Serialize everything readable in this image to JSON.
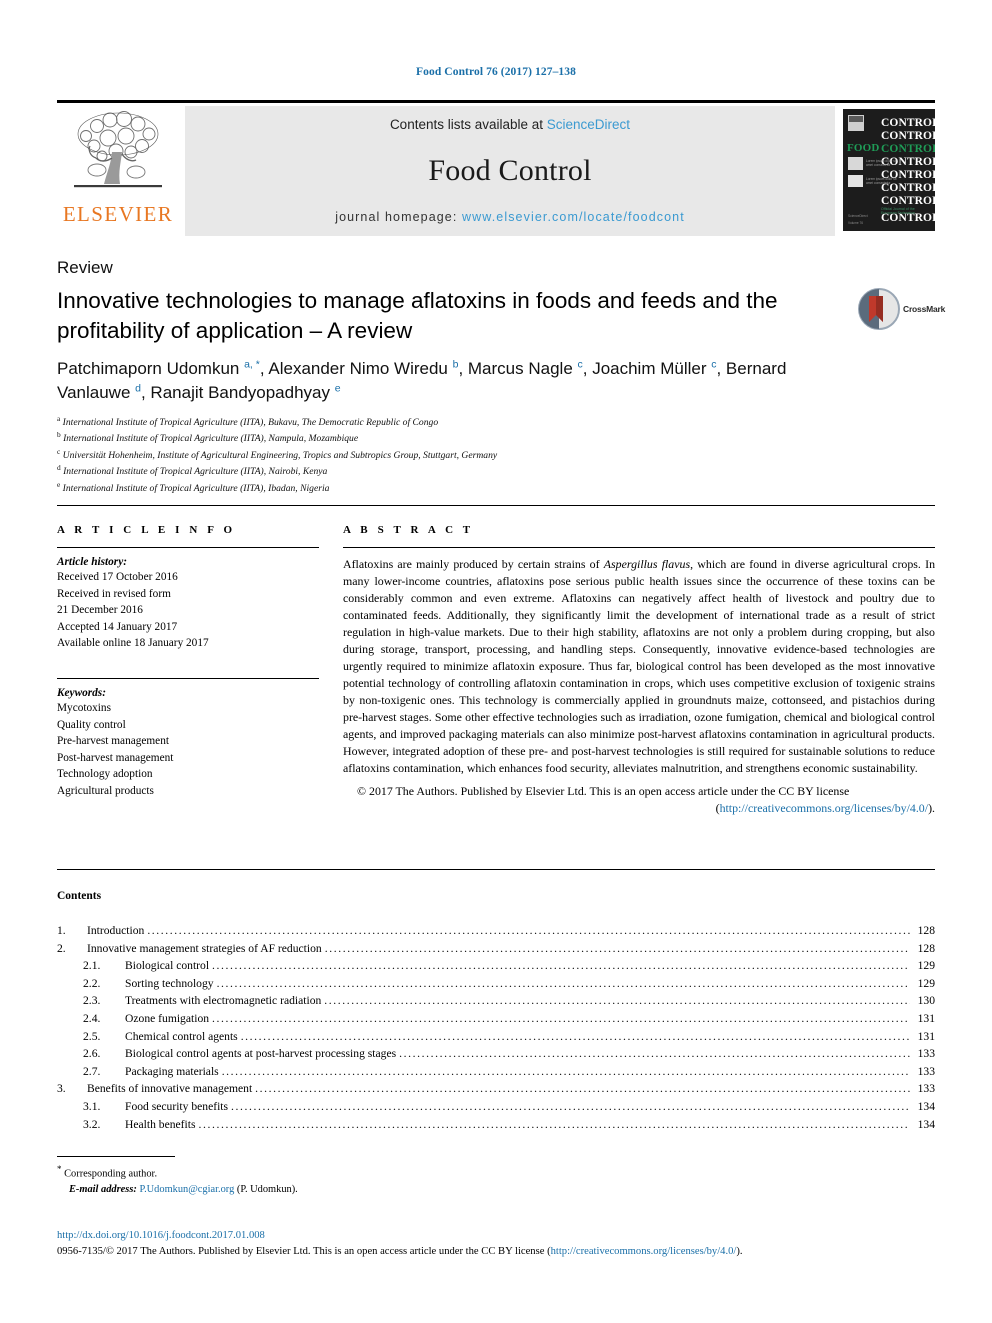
{
  "running_head": "Food Control 76 (2017) 127–138",
  "masthead": {
    "publisher_name": "ELSEVIER",
    "contents_prefix": "Contents lists available at ",
    "contents_link": "ScienceDirect",
    "journal_name": "Food Control",
    "homepage_prefix": "journal homepage: ",
    "homepage_url": "www.elsevier.com/locate/foodcont",
    "cover_brand_food": "FOOD",
    "cover_brand_control": "CONTROL"
  },
  "article": {
    "doctype": "Review",
    "title": "Innovative technologies to manage aflatoxins in foods and feeds and the profitability of application – A review",
    "crossmark_label": "CrossMark",
    "authors_html": "Patchimaporn Udomkun <sup>a, *</sup>, Alexander Nimo Wiredu <sup>b</sup>, Marcus Nagle <sup>c</sup>, Joachim Müller <sup>c</sup>, Bernard Vanlauwe <sup>d</sup>, Ranajit Bandyopadhyay <sup>e</sup>",
    "affiliations": [
      {
        "marker": "a",
        "text": "International Institute of Tropical Agriculture (IITA), Bukavu, The Democratic Republic of Congo"
      },
      {
        "marker": "b",
        "text": "International Institute of Tropical Agriculture (IITA), Nampula, Mozambique"
      },
      {
        "marker": "c",
        "text": "Universität Hohenheim, Institute of Agricultural Engineering, Tropics and Subtropics Group, Stuttgart, Germany"
      },
      {
        "marker": "d",
        "text": "International Institute of Tropical Agriculture (IITA), Nairobi, Kenya"
      },
      {
        "marker": "e",
        "text": "International Institute of Tropical Agriculture (IITA), Ibadan, Nigeria"
      }
    ]
  },
  "article_info": {
    "heading": "A R T I C L E  I N F O",
    "history_title": "Article history:",
    "history_lines": [
      "Received 17 October 2016",
      "Received in revised form",
      "21 December 2016",
      "Accepted 14 January 2017",
      "Available online 18 January 2017"
    ],
    "keywords_title": "Keywords:",
    "keywords": [
      "Mycotoxins",
      "Quality control",
      "Pre-harvest management",
      "Post-harvest management",
      "Technology adoption",
      "Agricultural products"
    ]
  },
  "abstract": {
    "heading": "A B S T R A C T",
    "body_html": "Aflatoxins are mainly produced by certain strains of <span class=\"italic\">Aspergillus flavus</span>, which are found in diverse agricultural crops. In many lower-income countries, aflatoxins pose serious public health issues since the occurrence of these toxins can be considerably common and even extreme. Aflatoxins can negatively affect health of livestock and poultry due to contaminated feeds. Additionally, they significantly limit the development of international trade as a result of strict regulation in high-value markets. Due to their high stability, aflatoxins are not only a problem during cropping, but also during storage, transport, processing, and handling steps. Consequently, innovative evidence-based technologies are urgently required to minimize aflatoxin exposure. Thus far, biological control has been developed as the most innovative potential technology of controlling aflatoxin contamination in crops, which uses competitive exclusion of toxigenic strains by non-toxigenic ones. This technology is commercially applied in groundnuts maize, cottonseed, and pistachios during pre-harvest stages. Some other effective technologies such as irradiation, ozone fumigation, chemical and biological control agents, and improved packaging materials can also minimize post-harvest aflatoxins contamination in agricultural products. However, integrated adoption of these pre- and post-harvest technologies is still required for sustainable solutions to reduce aflatoxins contamination, which enhances food security, alleviates malnutrition, and strengthens economic sustainability.",
    "copyright_text": "© 2017 The Authors. Published by Elsevier Ltd. This is an open access article under the CC BY license",
    "license_open_paren": "(",
    "license_url": "http://creativecommons.org/licenses/by/4.0/",
    "license_close_paren": ").",
    "copyright_symbol": "©"
  },
  "contents": {
    "heading": "Contents",
    "entries": [
      {
        "num": "1.",
        "label": "Introduction",
        "page": "128",
        "level": 1
      },
      {
        "num": "2.",
        "label": "Innovative management strategies of AF reduction",
        "page": "128",
        "level": 1
      },
      {
        "num": "2.1.",
        "label": "Biological control",
        "page": "129",
        "level": 2
      },
      {
        "num": "2.2.",
        "label": "Sorting technology",
        "page": "129",
        "level": 2
      },
      {
        "num": "2.3.",
        "label": "Treatments with electromagnetic radiation",
        "page": "130",
        "level": 2
      },
      {
        "num": "2.4.",
        "label": "Ozone fumigation",
        "page": "131",
        "level": 2
      },
      {
        "num": "2.5.",
        "label": "Chemical control agents",
        "page": "131",
        "level": 2
      },
      {
        "num": "2.6.",
        "label": "Biological control agents at post-harvest processing stages",
        "page": "133",
        "level": 2
      },
      {
        "num": "2.7.",
        "label": "Packaging materials",
        "page": "133",
        "level": 2
      },
      {
        "num": "3.",
        "label": "Benefits of innovative management",
        "page": "133",
        "level": 1
      },
      {
        "num": "3.1.",
        "label": "Food security benefits",
        "page": "134",
        "level": 2
      },
      {
        "num": "3.2.",
        "label": "Health benefits",
        "page": "134",
        "level": 2
      }
    ]
  },
  "footer": {
    "corresponding_star": "*",
    "corresponding_label": "Corresponding author.",
    "email_label": "E-mail address:",
    "email": "P.Udomkun@cgiar.org",
    "email_suffix": "(P. Udomkun).",
    "doi_url": "http://dx.doi.org/10.1016/j.foodcont.2017.01.008",
    "issn_prefix": "0956-7135/© 2017 The Authors. Published by Elsevier Ltd. This is an open access article under the CC BY license (",
    "issn_license_url": "http://creativecommons.org/licenses/by/4.0/",
    "issn_suffix": ")."
  },
  "colors": {
    "link_blue": "#1a6fa8",
    "light_blue": "#3b9ad1",
    "elsevier_orange": "#E87722",
    "band_gray": "#e8e8e8",
    "cover_green": "#1f7a46"
  }
}
